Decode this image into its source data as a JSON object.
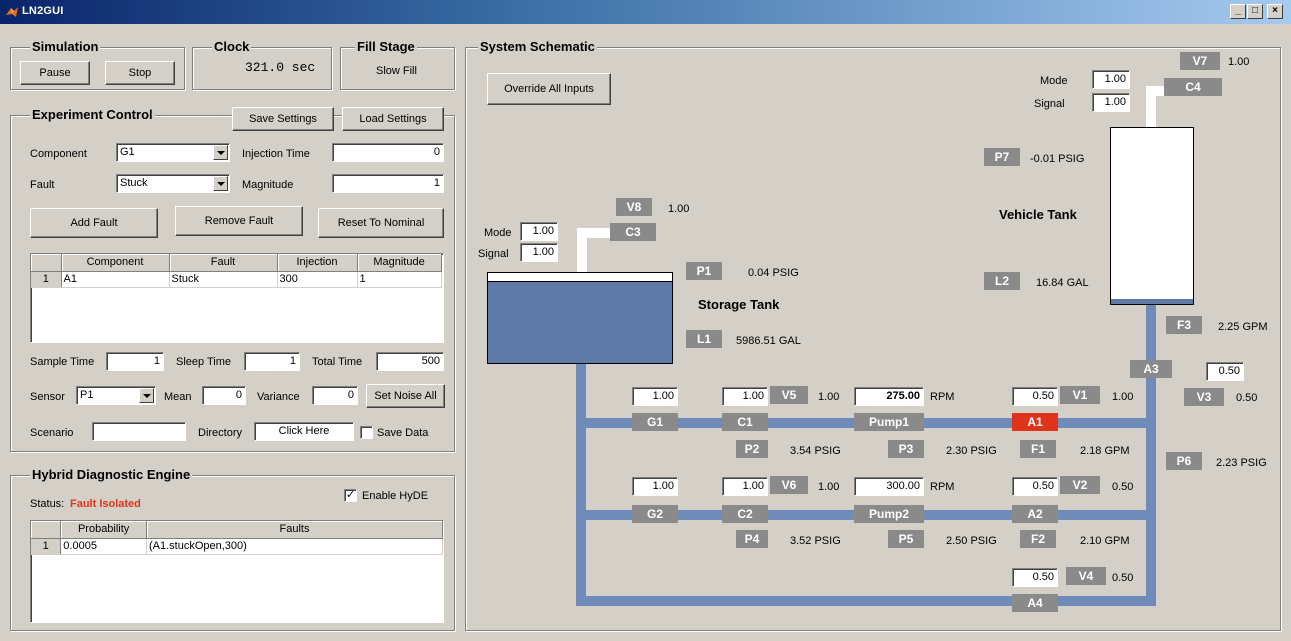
{
  "window": {
    "title": "LN2GUI",
    "min": "_",
    "max": "□",
    "close": "×"
  },
  "simulation": {
    "title": "Simulation",
    "pause": "Pause",
    "stop": "Stop"
  },
  "clock": {
    "title": "Clock",
    "value": "321.0 sec"
  },
  "fill_stage": {
    "title": "Fill Stage",
    "value": "Slow Fill"
  },
  "experiment": {
    "title": "Experiment Control",
    "save": "Save Settings",
    "load": "Load Settings",
    "component_label": "Component",
    "component_value": "G1",
    "injection_label": "Injection Time",
    "injection_value": "0",
    "fault_label": "Fault",
    "fault_value": "Stuck",
    "magnitude_label": "Magnitude",
    "magnitude_value": "1",
    "add_fault": "Add Fault",
    "remove_fault": "Remove Fault",
    "reset": "Reset To Nominal",
    "table_headers": [
      "Component",
      "Fault",
      "Injection",
      "Magnitude"
    ],
    "table_rows": [
      [
        "1",
        "A1",
        "Stuck",
        "300",
        "1"
      ]
    ],
    "sample_time_label": "Sample Time",
    "sample_time": "1",
    "sleep_time_label": "Sleep Time",
    "sleep_time": "1",
    "total_time_label": "Total Time",
    "total_time": "500",
    "sensor_label": "Sensor",
    "sensor_value": "P1",
    "mean_label": "Mean",
    "mean_value": "0",
    "variance_label": "Variance",
    "variance_value": "0",
    "set_noise": "Set Noise All",
    "scenario_label": "Scenario",
    "scenario_value": "",
    "directory_label": "Directory",
    "directory_value": "Click Here",
    "save_data_label": "Save Data"
  },
  "hyde": {
    "title": "Hybrid Diagnostic Engine",
    "status_label": "Status:",
    "status_value": "Fault Isolated",
    "status_color": "#e0341a",
    "enable_label": "Enable HyDE",
    "table_headers": [
      "Probability",
      "Faults"
    ],
    "table_rows": [
      [
        "1",
        "0.0005",
        "(A1.stuckOpen,300)"
      ]
    ]
  },
  "schematic": {
    "title": "System Schematic",
    "override": "Override All Inputs",
    "storage_tank_label": "Storage Tank",
    "vehicle_tank_label": "Vehicle Tank",
    "mode_label": "Mode",
    "signal_label": "Signal",
    "c3_mode": "1.00",
    "c3_signal": "1.00",
    "c4_mode": "1.00",
    "c4_signal": "1.00",
    "tags": {
      "V7": "V7",
      "C4": "C4",
      "P7": "P7",
      "V8": "V8",
      "C3": "C3",
      "P1": "P1",
      "L1": "L1",
      "L2": "L2",
      "F3": "F3",
      "A3": "A3",
      "V3": "V3",
      "P6": "P6",
      "G1": "G1",
      "C1": "C1",
      "V5": "V5",
      "Pump1": "Pump1",
      "V1": "V1",
      "A1": "A1",
      "P2": "P2",
      "P3": "P3",
      "F1": "F1",
      "G2": "G2",
      "C2": "C2",
      "V6": "V6",
      "Pump2": "Pump2",
      "V2": "V2",
      "A2": "A2",
      "P4": "P4",
      "P5": "P5",
      "F2": "F2",
      "V4": "V4",
      "A4": "A4"
    },
    "values": {
      "V7": "1.00",
      "P7": "-0.01  PSIG",
      "V8": "1.00",
      "P1": "0.04  PSIG",
      "L1": "5986.51  GAL",
      "L2": "16.84  GAL",
      "F3": "2.25  GPM",
      "V3": "0.50",
      "P6": "2.23  PSIG",
      "V5": "1.00",
      "V1": "1.00",
      "P2": "3.54  PSIG",
      "P3": "2.30  PSIG",
      "F1": "2.18  GPM",
      "V6": "1.00",
      "V2": "0.50",
      "P4": "3.52  PSIG",
      "P5": "2.50  PSIG",
      "F2": "2.10  GPM",
      "V4": "0.50",
      "rpm1": "RPM",
      "rpm2": "RPM"
    },
    "inputs": {
      "G1": "1.00",
      "C1": "1.00",
      "Pump1": "275.00",
      "V1": "0.50",
      "A3": "0.50",
      "G2": "1.00",
      "C2": "1.00",
      "Pump2": "300.00",
      "V2": "0.50",
      "V4": "0.50"
    },
    "colors": {
      "pipe": "#6f8cb8",
      "tag": "#8a8a8a",
      "fault": "#e0341a"
    }
  }
}
